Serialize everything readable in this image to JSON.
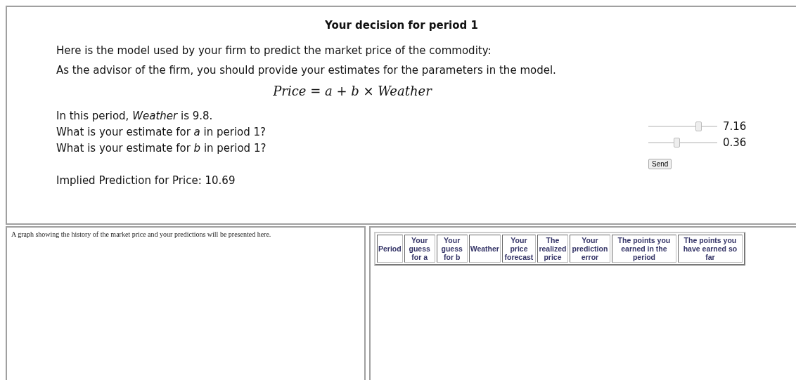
{
  "title": "Your decision for period 1",
  "intro": [
    "Here is the model used by your firm to predict the market price of the commodity:",
    "As the advisor of the firm, you should provide your estimates for the parameters in the model."
  ],
  "formula": "*Price* = *a* + *b* × *Weather*",
  "questions": [
    "In this period, *Weather* is 9.8.",
    "What is your estimate for *a* in period 1?",
    "What is your estimate for *b* in period 1?"
  ],
  "sliders": [
    {
      "level": 0.74,
      "reading": "7.16"
    },
    {
      "level": 0.4,
      "reading": "0.36"
    }
  ],
  "send_button": "Send",
  "implied_prediction": "Implied Prediction for Price: 10.69",
  "graph_placeholder": "A graph showing the history of the market price and your predictions will be presented here.",
  "table": {
    "columns": [
      "Period",
      "Your guess for a",
      "Your guess for b",
      "Weather",
      "Your price forecast",
      "The realized price",
      "Your prediction error",
      "The points you earned in the period",
      "The points you have earned so far"
    ]
  }
}
